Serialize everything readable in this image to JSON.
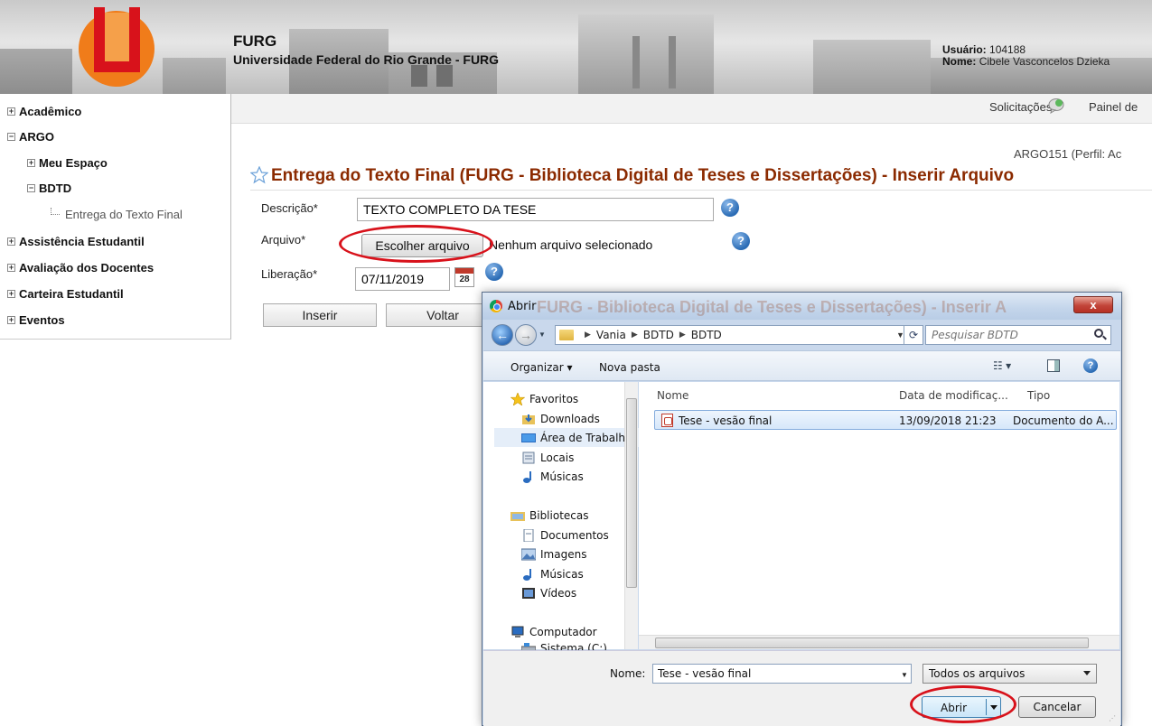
{
  "header": {
    "title": "FURG",
    "subtitle": "Universidade Federal do Rio Grande - FURG",
    "user_label": "Usuário:",
    "user_value": "104188",
    "name_label": "Nome:",
    "name_value": "Cibele Vasconcelos Dzieka"
  },
  "sidebar": {
    "items": [
      {
        "label": "Acadêmico",
        "toggle": "+"
      },
      {
        "label": "ARGO",
        "toggle": "−"
      },
      {
        "label": "Meu Espaço",
        "toggle": "+"
      },
      {
        "label": "BDTD",
        "toggle": "−"
      },
      {
        "label": "Entrega do Texto Final"
      },
      {
        "label": "Assistência Estudantil",
        "toggle": "+"
      },
      {
        "label": "Avaliação dos Docentes",
        "toggle": "+"
      },
      {
        "label": "Carteira Estudantil",
        "toggle": "+"
      },
      {
        "label": "Eventos",
        "toggle": "+"
      }
    ]
  },
  "topbar": {
    "solicitacoes": "Solicitações",
    "painel": "Painel de"
  },
  "page": {
    "code": "ARGO151  (Perfil: Ac",
    "heading": "Entrega do Texto Final (FURG - Biblioteca Digital de Teses e Dissertações) - Inserir Arquivo",
    "fields": {
      "descricao_label": "Descrição",
      "descricao_value": "TEXTO COMPLETO DA TESE",
      "arquivo_label": "Arquivo",
      "file_button": "Escolher arquivo",
      "file_status": "Nenhum arquivo selecionado",
      "liberacao_label": "Liberação",
      "liberacao_value": "07/11/2019",
      "calendar_day": "28",
      "required_mark": "*",
      "help_glyph": "?"
    },
    "buttons": {
      "inserir": "Inserir",
      "voltar": "Voltar"
    }
  },
  "dialog": {
    "title": "Abrir",
    "close": "x",
    "ghost_heading": "FURG - Biblioteca Digital de Teses e Dissertações) - Inserir A",
    "breadcrumb": [
      "Vania",
      "BDTD",
      "BDTD"
    ],
    "search_placeholder": "Pesquisar BDTD",
    "toolbar": {
      "organizar": "Organizar ▾",
      "nova_pasta": "Nova pasta"
    },
    "nav_items": [
      {
        "label": "Favoritos",
        "icon": "star-icon"
      },
      {
        "label": "Downloads",
        "icon": "downloads-icon"
      },
      {
        "label": "Área de Trabalho",
        "icon": "desktop-icon"
      },
      {
        "label": "Locais",
        "icon": "places-icon"
      },
      {
        "label": "Músicas",
        "icon": "music-icon"
      },
      {
        "label": "Bibliotecas",
        "icon": "libraries-icon"
      },
      {
        "label": "Documentos",
        "icon": "documents-icon"
      },
      {
        "label": "Imagens",
        "icon": "images-icon"
      },
      {
        "label": "Músicas",
        "icon": "music-icon"
      },
      {
        "label": "Vídeos",
        "icon": "videos-icon"
      },
      {
        "label": "Computador",
        "icon": "computer-icon"
      },
      {
        "label": "Sistema (C:)",
        "icon": "drive-icon"
      }
    ],
    "columns": {
      "nome": "Nome",
      "data": "Data de modificaç...",
      "tipo": "Tipo"
    },
    "file": {
      "name": "Tese - vesão final",
      "date": "13/09/2018 21:23",
      "type": "Documento do A..."
    },
    "bottom": {
      "name_label": "Nome:",
      "name_value": "Tese - vesão final",
      "filter": "Todos os arquivos",
      "open": "Abrir",
      "cancel": "Cancelar"
    }
  },
  "colors": {
    "heading": "#8b2a00",
    "highlight_ellipse": "#d8121b"
  }
}
